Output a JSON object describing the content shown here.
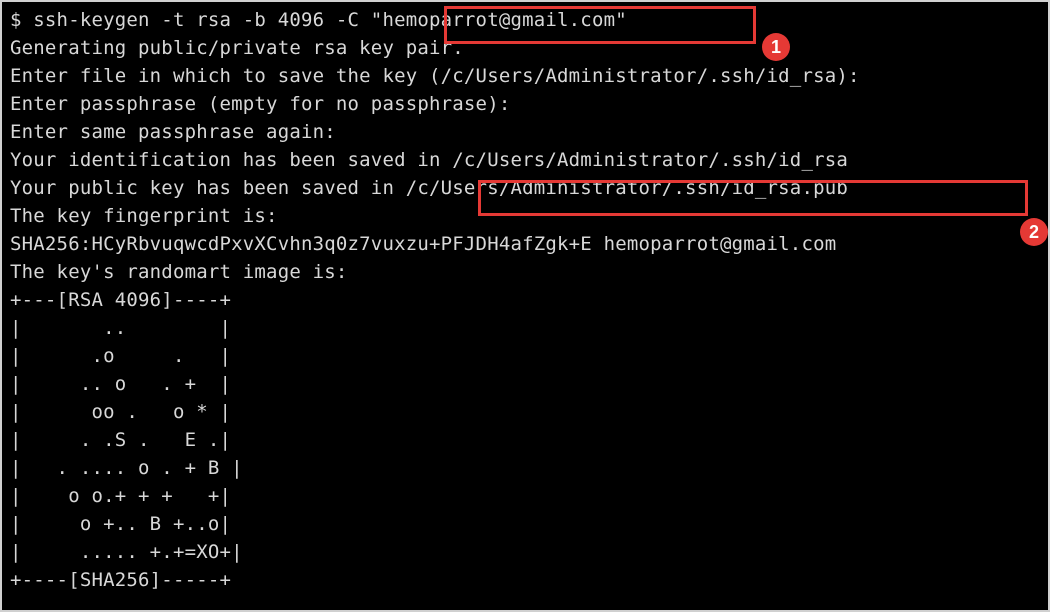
{
  "terminal": {
    "lines": [
      "$ ssh-keygen -t rsa -b 4096 -C \"hemoparrot@gmail.com\"",
      "Generating public/private rsa key pair.",
      "Enter file in which to save the key (/c/Users/Administrator/.ssh/id_rsa):",
      "Enter passphrase (empty for no passphrase):",
      "Enter same passphrase again:",
      "Your identification has been saved in /c/Users/Administrator/.ssh/id_rsa",
      "Your public key has been saved in /c/Users/Administrator/.ssh/id_rsa.pub",
      "The key fingerprint is:",
      "SHA256:HCyRbvuqwcdPxvXCvhn3q0z7vuxzu+PFJDH4afZgk+E hemoparrot@gmail.com",
      "The key's randomart image is:",
      "+---[RSA 4096]----+",
      "|       ..        |",
      "|      .o     .   |",
      "|     .. o   . +  |",
      "|      oo .   o * |",
      "|     . .S .   E .|",
      "|   . .... o . + B |",
      "|    o o.+ + +   +|",
      "|     o +.. B +..o|",
      "|     ..... +.+=XO+|",
      "+----[SHA256]-----+"
    ]
  },
  "annotations": {
    "badge_1": "1",
    "badge_2": "2",
    "highlight_color": "#e53935"
  }
}
